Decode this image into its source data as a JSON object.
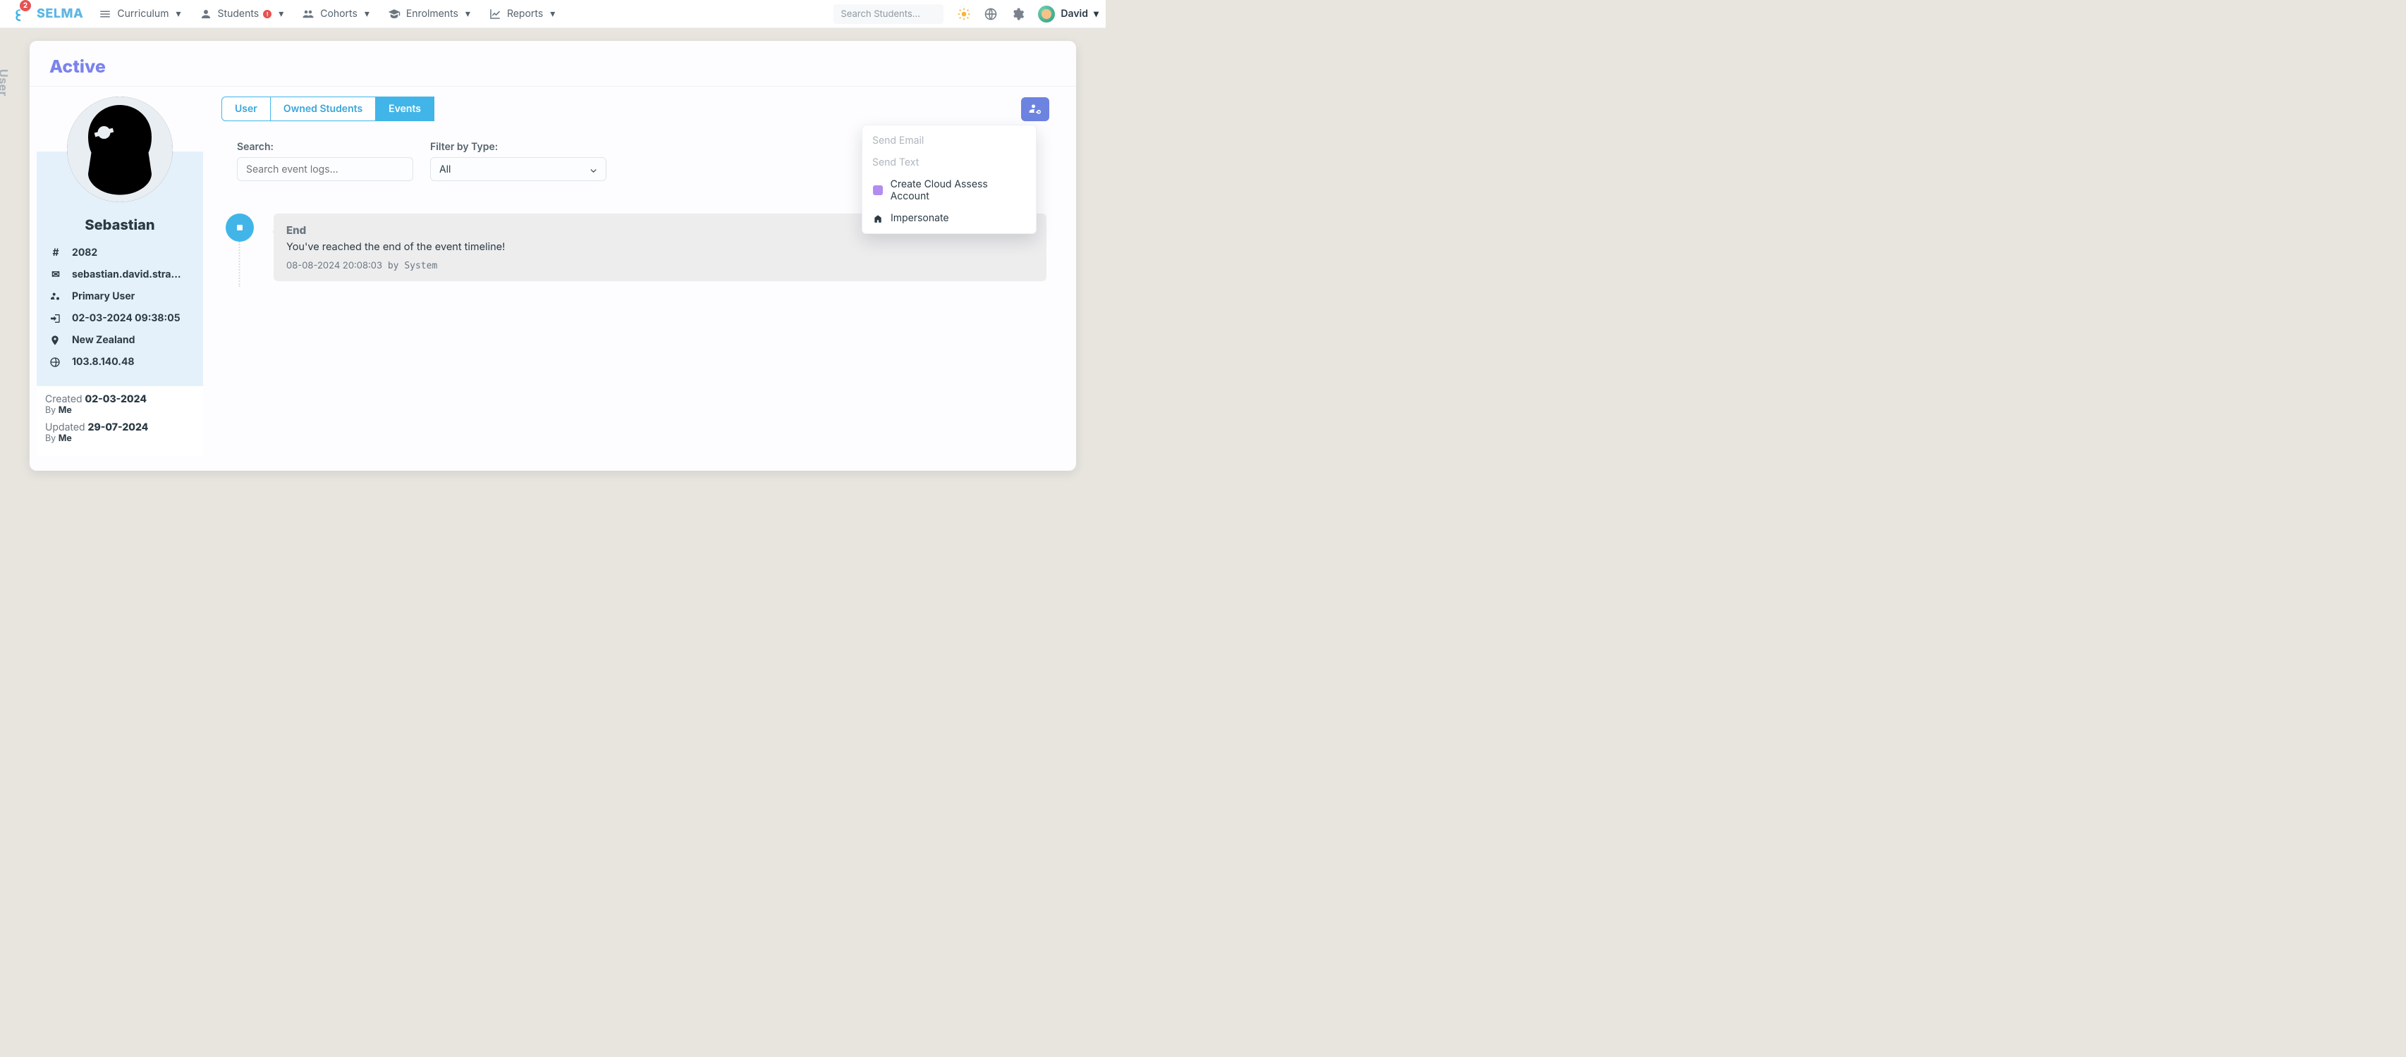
{
  "header": {
    "notif_count": "2",
    "brand": "SELMA",
    "nav": {
      "curriculum": "Curriculum",
      "students": "Students",
      "students_badge": "!",
      "cohorts": "Cohorts",
      "enrolments": "Enrolments",
      "reports": "Reports"
    },
    "search_placeholder": "Search Students...",
    "user_name": "David"
  },
  "page": {
    "side_label": "User",
    "status": "Active"
  },
  "profile": {
    "first_name": "Sebastian",
    "id": "2082",
    "email": "sebastian.david.stra...",
    "role": "Primary User",
    "last_login": "02-03-2024 09:38:05",
    "country": "New Zealand",
    "ip": "103.8.140.48",
    "created_label": "Created",
    "created_date": "02-03-2024",
    "created_by_label": "By",
    "created_by": "Me",
    "updated_label": "Updated",
    "updated_date": "29-07-2024",
    "updated_by_label": "By",
    "updated_by": "Me"
  },
  "tabs": {
    "user": "User",
    "owned": "Owned Students",
    "events": "Events"
  },
  "filters": {
    "search_label": "Search:",
    "search_placeholder": "Search event logs...",
    "type_label": "Filter by Type:",
    "type_value": "All"
  },
  "timeline": {
    "title": "End",
    "body": "You've reached the end of the event timeline!",
    "timestamp": "08-08-2024 20:08:03",
    "by_label": "by",
    "by": "System"
  },
  "actions": {
    "send_email": "Send Email",
    "send_text": "Send Text",
    "cloud_assess": "Create Cloud Assess Account",
    "impersonate": "Impersonate"
  }
}
